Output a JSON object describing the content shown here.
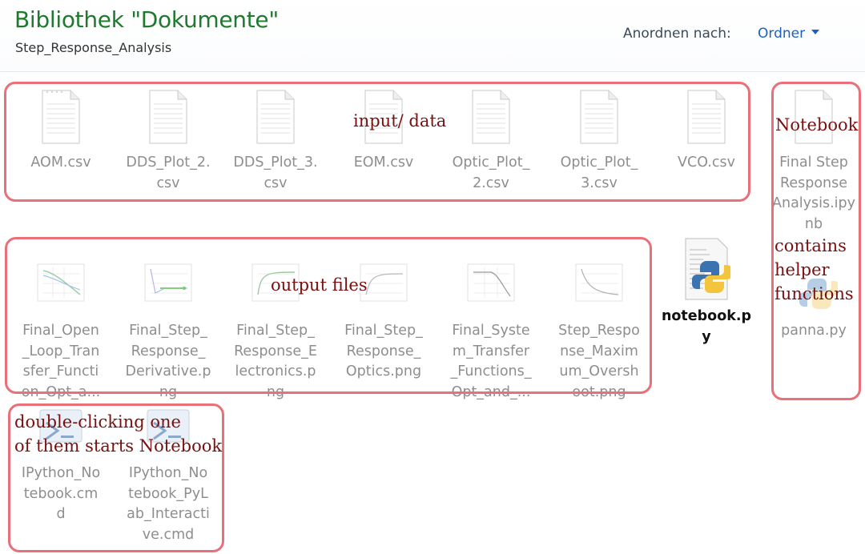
{
  "header": {
    "title": "Bibliothek \"Dokumente\"",
    "subtitle": "Step_Response_Analysis",
    "arrange_label": "Anordnen nach:",
    "arrange_value": "Ordner"
  },
  "files": [
    {
      "name": "AOM.csv",
      "icon": "csv-file-icon"
    },
    {
      "name": "DDS_Plot_2.\ncsv",
      "icon": "csv-file-icon"
    },
    {
      "name": "DDS_Plot_3.\ncsv",
      "icon": "csv-file-icon"
    },
    {
      "name": "EOM.csv",
      "icon": "csv-file-icon"
    },
    {
      "name": "Optic_Plot_\n2.csv",
      "icon": "csv-file-icon"
    },
    {
      "name": "Optic_Plot_\n3.csv",
      "icon": "csv-file-icon"
    },
    {
      "name": "VCO.csv",
      "icon": "csv-file-icon"
    },
    {
      "name": "Final Step\nResponse\nAnalysis.ipy\nnb",
      "icon": "ipynb-file-icon"
    },
    {
      "name": "Final_Open\n_Loop_Tran\nsfer_Functi\non_Opt_a...",
      "icon": "png-plot-icon"
    },
    {
      "name": "Final_Step_\nResponse_\nDerivative.p\nng",
      "icon": "png-plot-icon"
    },
    {
      "name": "Final_Step_\nResponse_E\nlectronics.p\nng",
      "icon": "png-plot-icon"
    },
    {
      "name": "Final_Step_\nResponse_\nOptics.png",
      "icon": "png-plot-icon"
    },
    {
      "name": "Final_Syste\nm_Transfer\n_Functions_\nOpt_and_...",
      "icon": "png-plot-icon"
    },
    {
      "name": "Step_Respo\nnse_Maxim\num_Oversh\noot.png",
      "icon": "png-plot-icon"
    },
    {
      "name": "notebook.p\ny",
      "icon": "python-file-icon"
    },
    {
      "name": "panna.py",
      "icon": "python-file-icon"
    },
    {
      "name": "IPython_No\ntebook.cm\nd",
      "icon": "cmd-file-icon"
    },
    {
      "name": "IPython_No\ntebook_PyL\nab_Interacti\nve.cmd",
      "icon": "cmd-file-icon"
    }
  ],
  "annotations": {
    "input": "input/ data",
    "notebook": "Notebook",
    "output": "output files",
    "helper": "contains\nhelper\nfunctions",
    "double_click_1": "double-clicking one",
    "double_click_2": "of them starts Notebook"
  },
  "colors": {
    "title_green": "#1e7a2e",
    "link_blue": "#1f5fbf",
    "annotation_box": "#e96f78",
    "annotation_text": "#7a0f0f",
    "file_name_gray": "#8e8e8e"
  }
}
